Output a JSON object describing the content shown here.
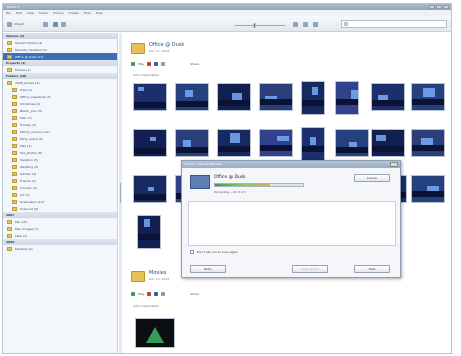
{
  "window": {
    "title": "Picasa 3"
  },
  "menu": [
    "File",
    "Edit",
    "View",
    "Folder",
    "Picture",
    "Create",
    "Tools",
    "Help"
  ],
  "toolbar": {
    "import": "Import",
    "search_placeholder": ""
  },
  "sidebar": {
    "sections": [
      {
        "label": "Albums (3)",
        "items": [
          {
            "label": "Starred Photos (3)",
            "selected": false
          },
          {
            "label": "Recently Updated (2)",
            "selected": false
          },
          {
            "label": "Office @ Dusk (17)",
            "selected": true
          }
        ]
      },
      {
        "label": "Projects (1)",
        "items": [
          {
            "label": "Movies (1)",
            "selected": false
          }
        ]
      },
      {
        "label": "Folders (28)",
        "items": [
          {
            "label": "2008_photos (2)",
            "selected": false
          },
          {
            "label": "Trips (1)",
            "selected": false
          },
          {
            "label": "Office_snapshots (3)",
            "selected": false
          },
          {
            "label": "Christmas (4)",
            "selected": false
          },
          {
            "label": "Beach_pics (3)",
            "selected": false
          },
          {
            "label": "Misc (7)",
            "selected": false
          },
          {
            "label": "Holiday (2)",
            "selected": false
          },
          {
            "label": "Family_reunion (12)",
            "selected": false
          },
          {
            "label": "Party_event (5)",
            "selected": false
          },
          {
            "label": "Pets (3)",
            "selected": false
          },
          {
            "label": "Old_photos (8)",
            "selected": false
          },
          {
            "label": "Vacation (5)",
            "selected": false
          },
          {
            "label": "Wedding (2)",
            "selected": false
          },
          {
            "label": "Garden (3)",
            "selected": false
          },
          {
            "label": "Friends (2)",
            "selected": false
          },
          {
            "label": "Concert (4)",
            "selected": false
          },
          {
            "label": "Art (3)",
            "selected": false
          },
          {
            "label": "Graduation (10)",
            "selected": false
          },
          {
            "label": "Scanned (6)",
            "selected": false
          }
        ]
      },
      {
        "label": "2007",
        "items": [
          {
            "label": "Fall (15)",
            "selected": false
          },
          {
            "label": "Misc images (7)",
            "selected": false
          },
          {
            "label": "Lake (2)",
            "selected": false
          }
        ]
      },
      {
        "label": "2006",
        "items": [
          {
            "label": "Desktop (4)",
            "selected": false
          }
        ]
      }
    ]
  },
  "album": {
    "title": "Office @ Dusk",
    "date": "Dec 12, 2008",
    "actions": [
      "Play",
      "Share"
    ],
    "section_label": "Add a description"
  },
  "second_album": {
    "title": "Movies",
    "date": "Dec 10, 2008",
    "actions": [
      "Play",
      "Share"
    ],
    "section_label": "Add a description"
  },
  "dialog": {
    "title": "Picasa - Upload Manager",
    "item_name": "Office @ Dusk",
    "progress": 0.62,
    "status": "Uploading... (9 of 17)",
    "cancel": "Cancel",
    "checkbox": "Don't ask me to view again",
    "buttons": [
      "Retry",
      "View Online",
      "Hide"
    ]
  }
}
